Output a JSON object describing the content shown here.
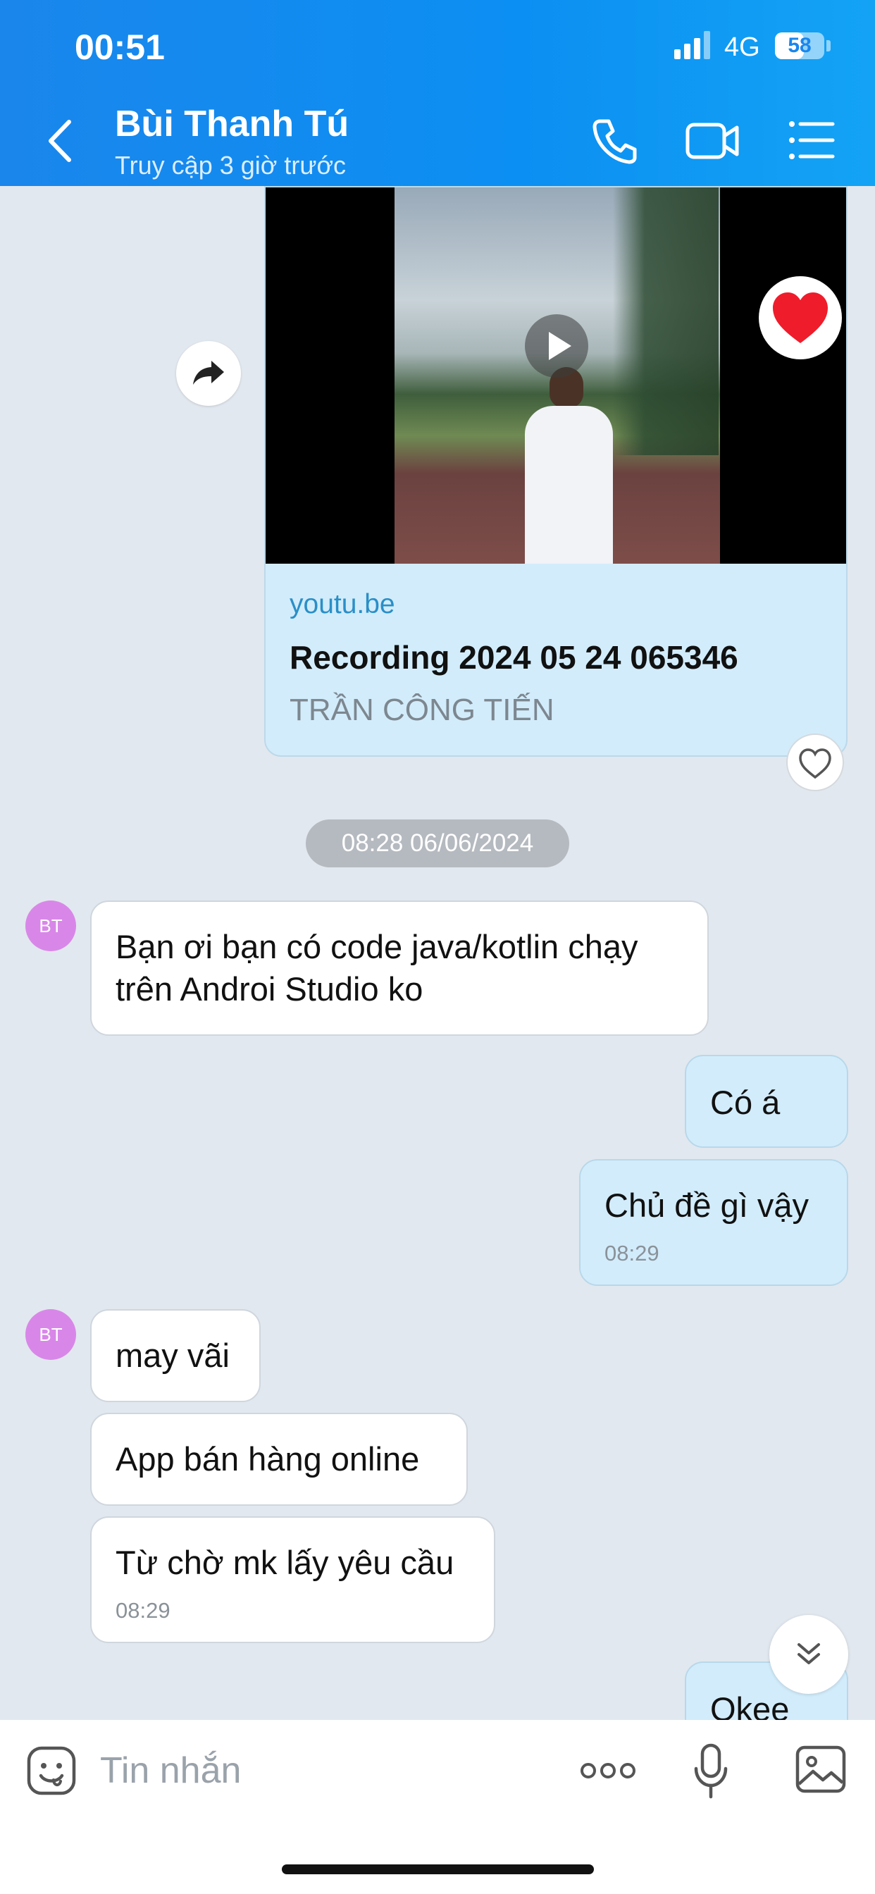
{
  "status_bar": {
    "time": "00:51",
    "network": "4G",
    "battery": "58",
    "battery_level": 0.58
  },
  "header": {
    "contact_name": "Bùi Thanh Tú",
    "status": "Truy cập 3 giờ trước"
  },
  "shared_link": {
    "domain": "youtu.be",
    "title": "Recording 2024 05 24 065346",
    "author": "TRẦN CÔNG TIẾN",
    "reaction": "heart-icon"
  },
  "date_separator": "08:28 06/06/2024",
  "messages": [
    {
      "sender": "BT",
      "line1": "Bạn ơi bạn có code java/kotlin chạy",
      "line2": "trên  Androi Studio ko"
    },
    {
      "sender": "me",
      "text": "Có á"
    },
    {
      "sender": "me",
      "text": "Chủ đề gì vậy",
      "time": "08:29"
    },
    {
      "sender": "BT",
      "text": "may vãi"
    },
    {
      "sender": "BT",
      "text": "App bán hàng online"
    },
    {
      "sender": "BT",
      "text": "Từ chờ mk lấy yêu cầu",
      "time": "08:29"
    },
    {
      "sender": "me",
      "text": "Okee"
    }
  ],
  "avatar_initials": "BT",
  "composer": {
    "placeholder": "Tin nhắn"
  },
  "colors": {
    "header": "#0c8ff2",
    "my_bubble": "#d2ecfb",
    "avatar": "#d887e8",
    "link": "#2a8fc7"
  }
}
